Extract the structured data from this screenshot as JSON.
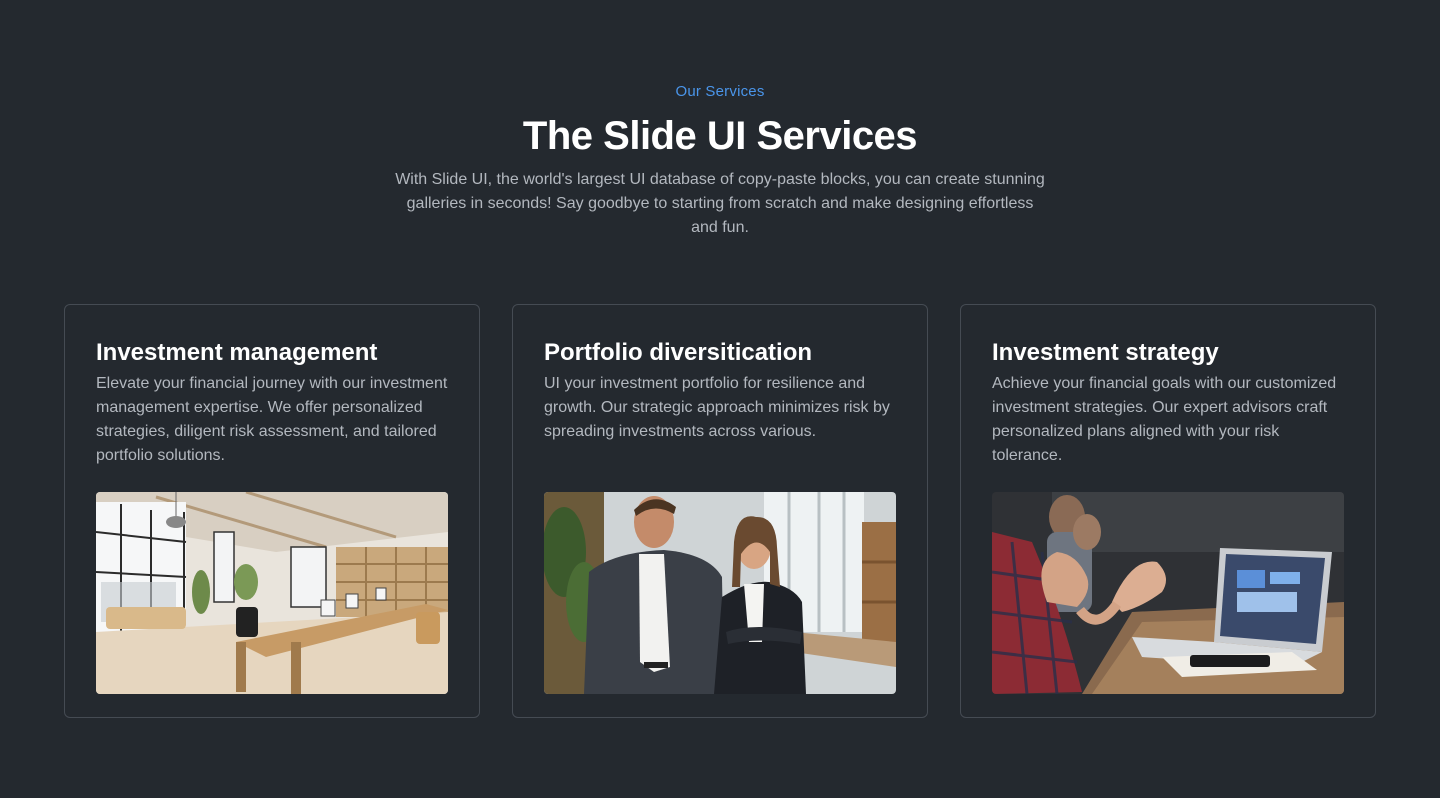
{
  "header": {
    "eyebrow": "Our Services",
    "title": "The Slide UI Services",
    "intro": "With Slide UI, the world's largest UI database of copy-paste blocks, you can create stunning galleries in seconds! Say goodbye to starting from scratch and make designing effortless and fun."
  },
  "cards": [
    {
      "title": "Investment management",
      "text": "Elevate your financial journey with our investment management expertise. We offer personalized strategies, diligent risk assessment, and tailored portfolio solutions.",
      "image": "bright-office-interior"
    },
    {
      "title": "Portfolio diversitication",
      "text": "UI your investment portfolio for resilience and growth. Our strategic approach minimizes risk by spreading investments across various.",
      "image": "business-team-portrait"
    },
    {
      "title": "Investment strategy",
      "text": "Achieve your financial goals with our customized investment strategies. Our expert advisors craft personalized plans aligned with your risk tolerance.",
      "image": "meeting-with-laptop"
    }
  ],
  "colors": {
    "background": "#24292f",
    "accent": "#4a95ea",
    "border": "#454b53",
    "muted_text": "#b3b8bf"
  }
}
